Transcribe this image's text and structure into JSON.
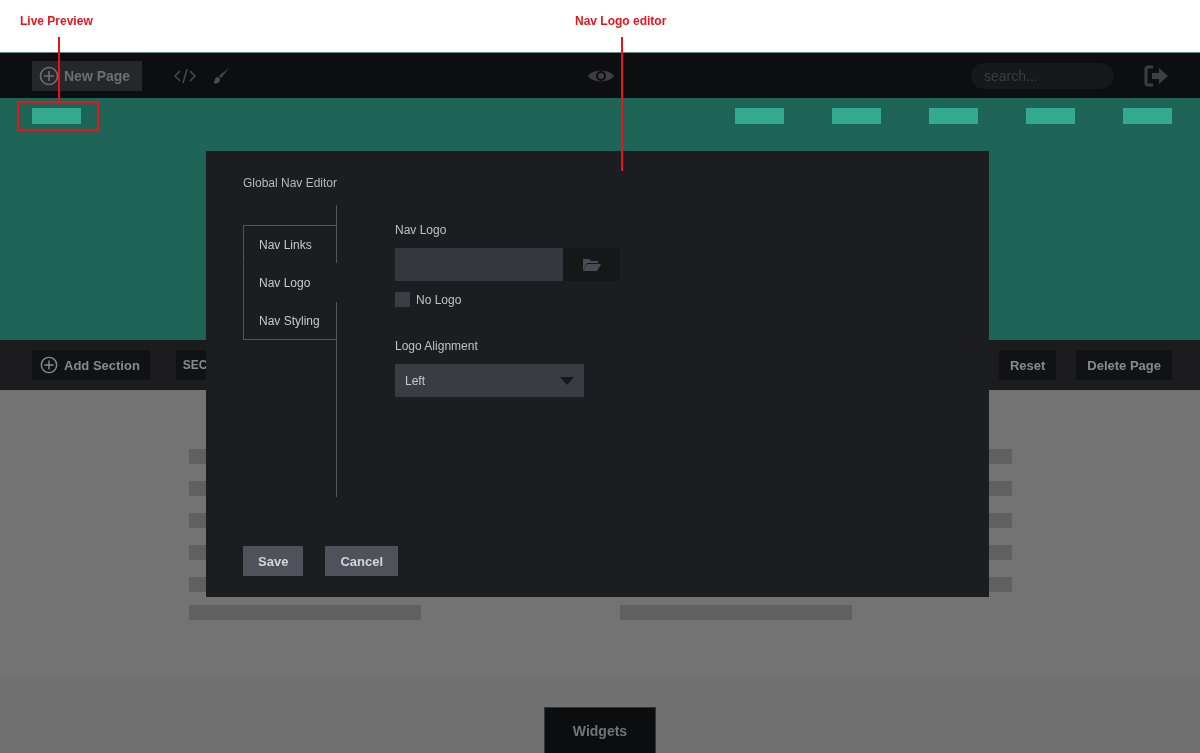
{
  "annotations": [
    {
      "label": "Live Preview"
    },
    {
      "label": "Nav Logo editor"
    }
  ],
  "top_bar": {
    "new_page_button": "New Page",
    "search": {
      "placeholder": "search..."
    }
  },
  "toolbar": {
    "left_buttons": [
      {
        "label": "Add Section",
        "kind": "add"
      },
      {
        "label": "SEC",
        "kind": "plain"
      }
    ],
    "right_buttons": [
      "Reset",
      "Delete Page"
    ]
  },
  "footer": {
    "button": "Widgets"
  },
  "modal": {
    "title": "Global Nav Editor",
    "tabs": [
      {
        "label": "Nav Links",
        "selected": false
      },
      {
        "label": "Nav Logo",
        "selected": true
      },
      {
        "label": "Nav Styling",
        "selected": false
      }
    ],
    "logo_field": {
      "label": "Nav Logo"
    },
    "no_logo": {
      "label": "No Logo",
      "checked": false
    },
    "alignment": {
      "label": "Logo Alignment",
      "value": "Left"
    },
    "buttons": [
      "Save",
      "Cancel"
    ]
  }
}
